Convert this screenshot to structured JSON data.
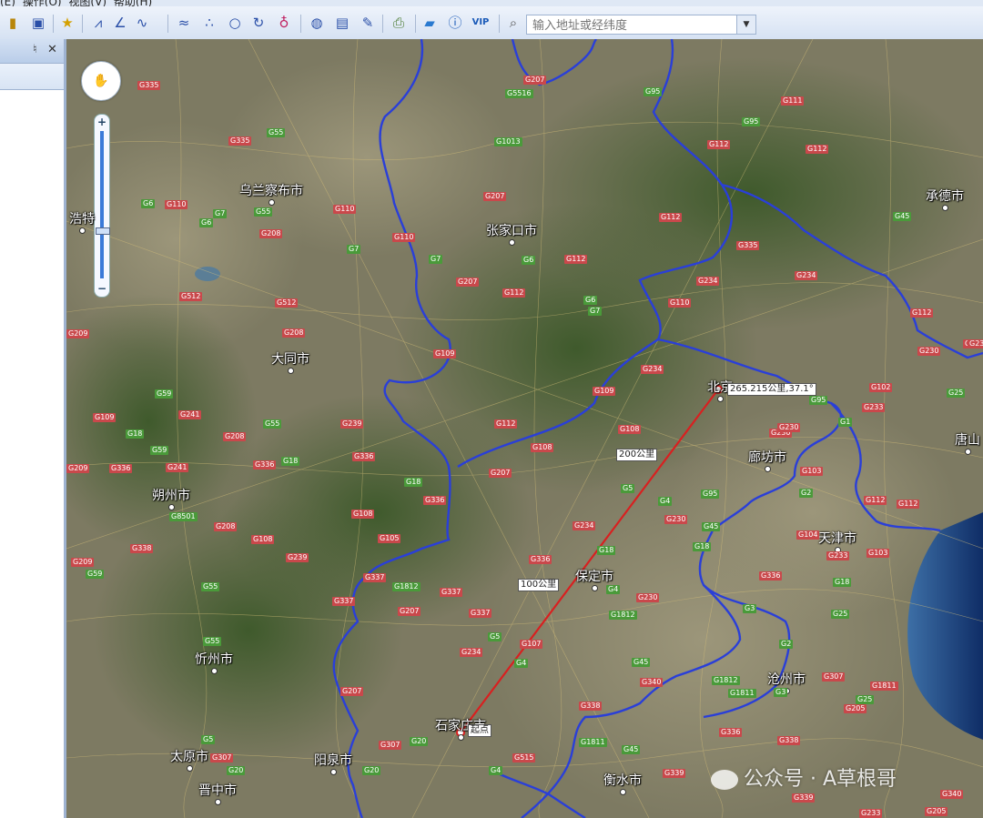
{
  "menu": {
    "items": [
      "(E)",
      "操作(O)",
      "视图(V)",
      "帮助(H)"
    ]
  },
  "toolbar": {
    "icons": [
      "ruler-icon",
      "screen-icon",
      "star-pin-icon",
      "polyline-icon",
      "angle-icon",
      "curve-icon",
      "road-icon",
      "points-icon",
      "circle-icon",
      "arc-icon",
      "ellipse-icon",
      "globe-icon",
      "map-icon",
      "pen-icon",
      "print-icon",
      "chat-icon",
      "info-icon",
      "vip-icon",
      "search-icon"
    ],
    "vip_label": "VIP",
    "search_placeholder": "输入地址或经纬度"
  },
  "panel": {
    "pin": "♮",
    "close": "✕"
  },
  "map": {
    "nav_glyph": "✋",
    "zoom_in": "+",
    "zoom_out": "−",
    "cities": [
      {
        "name": "乌兰察布市"
      },
      {
        "name": "张家口市"
      },
      {
        "name": "承德市"
      },
      {
        "name": "浩特"
      },
      {
        "name": "大同市"
      },
      {
        "name": "北京"
      },
      {
        "name": "廊坊市"
      },
      {
        "name": "唐山"
      },
      {
        "name": "朔州市"
      },
      {
        "name": "天津市"
      },
      {
        "name": "保定市"
      },
      {
        "name": "忻州市"
      },
      {
        "name": "沧州市"
      },
      {
        "name": "石家庄市"
      },
      {
        "name": "太原市"
      },
      {
        "name": "阳泉市"
      },
      {
        "name": "衡水市"
      },
      {
        "name": "晋中市"
      }
    ],
    "roads": [
      {
        "t": "r",
        "n": "G335"
      },
      {
        "t": "g",
        "n": "G5516"
      },
      {
        "t": "r",
        "n": "G207"
      },
      {
        "t": "g",
        "n": "G95"
      },
      {
        "t": "r",
        "n": "G111"
      },
      {
        "t": "r",
        "n": "G335"
      },
      {
        "t": "g",
        "n": "G55"
      },
      {
        "t": "g",
        "n": "G1013"
      },
      {
        "t": "g",
        "n": "G95"
      },
      {
        "t": "r",
        "n": "G112"
      },
      {
        "t": "r",
        "n": "G112"
      },
      {
        "t": "g",
        "n": "G6"
      },
      {
        "t": "r",
        "n": "G110"
      },
      {
        "t": "g",
        "n": "G7"
      },
      {
        "t": "g",
        "n": "G55"
      },
      {
        "t": "r",
        "n": "G110"
      },
      {
        "t": "r",
        "n": "G207"
      },
      {
        "t": "r",
        "n": "G112"
      },
      {
        "t": "g",
        "n": "G45"
      },
      {
        "t": "g",
        "n": "G6"
      },
      {
        "t": "r",
        "n": "G208"
      },
      {
        "t": "g",
        "n": "G7"
      },
      {
        "t": "r",
        "n": "G110"
      },
      {
        "t": "g",
        "n": "G7"
      },
      {
        "t": "g",
        "n": "G6"
      },
      {
        "t": "r",
        "n": "G112"
      },
      {
        "t": "r",
        "n": "G335"
      },
      {
        "t": "r",
        "n": "G234"
      },
      {
        "t": "r",
        "n": "G512"
      },
      {
        "t": "r",
        "n": "G512"
      },
      {
        "t": "r",
        "n": "G207"
      },
      {
        "t": "r",
        "n": "G112"
      },
      {
        "t": "g",
        "n": "G6"
      },
      {
        "t": "g",
        "n": "G7"
      },
      {
        "t": "r",
        "n": "G110"
      },
      {
        "t": "r",
        "n": "G234"
      },
      {
        "t": "r",
        "n": "G112"
      },
      {
        "t": "r",
        "n": "G209"
      },
      {
        "t": "r",
        "n": "G208"
      },
      {
        "t": "r",
        "n": "G230"
      },
      {
        "t": "r",
        "n": "G230"
      },
      {
        "t": "r",
        "n": "G109"
      },
      {
        "t": "r",
        "n": "G234"
      },
      {
        "t": "g",
        "n": "G59"
      },
      {
        "t": "r",
        "n": "G109"
      },
      {
        "t": "g",
        "n": "G95"
      },
      {
        "t": "r",
        "n": "G102"
      },
      {
        "t": "g",
        "n": "G25"
      },
      {
        "t": "r",
        "n": "G109"
      },
      {
        "t": "r",
        "n": "G241"
      },
      {
        "t": "r",
        "n": "G239"
      },
      {
        "t": "g",
        "n": "G55"
      },
      {
        "t": "r",
        "n": "G112"
      },
      {
        "t": "r",
        "n": "G108"
      },
      {
        "t": "r",
        "n": "G230"
      },
      {
        "t": "r",
        "n": "G233"
      },
      {
        "t": "g",
        "n": "G1"
      },
      {
        "t": "g",
        "n": "G18"
      },
      {
        "t": "r",
        "n": "G208"
      },
      {
        "t": "g",
        "n": "G59"
      },
      {
        "t": "r",
        "n": "G336"
      },
      {
        "t": "r",
        "n": "G108"
      },
      {
        "t": "r",
        "n": "G209"
      },
      {
        "t": "r",
        "n": "G336"
      },
      {
        "t": "r",
        "n": "G241"
      },
      {
        "t": "r",
        "n": "G336"
      },
      {
        "t": "g",
        "n": "G18"
      },
      {
        "t": "r",
        "n": "G207"
      },
      {
        "t": "r",
        "n": "G103"
      },
      {
        "t": "g",
        "n": "G18"
      },
      {
        "t": "g",
        "n": "G5"
      },
      {
        "t": "g",
        "n": "G95"
      },
      {
        "t": "g",
        "n": "G2"
      },
      {
        "t": "r",
        "n": "G336"
      },
      {
        "t": "g",
        "n": "G4"
      },
      {
        "t": "r",
        "n": "G112"
      },
      {
        "t": "g",
        "n": "G8501"
      },
      {
        "t": "r",
        "n": "G108"
      },
      {
        "t": "r",
        "n": "G230"
      },
      {
        "t": "r",
        "n": "G208"
      },
      {
        "t": "r",
        "n": "G108"
      },
      {
        "t": "r",
        "n": "G234"
      },
      {
        "t": "g",
        "n": "G45"
      },
      {
        "t": "r",
        "n": "G338"
      },
      {
        "t": "r",
        "n": "G239"
      },
      {
        "t": "r",
        "n": "G105"
      },
      {
        "t": "g",
        "n": "G18"
      },
      {
        "t": "g",
        "n": "G18"
      },
      {
        "t": "r",
        "n": "G104"
      },
      {
        "t": "r",
        "n": "G233"
      },
      {
        "t": "r",
        "n": "G103"
      },
      {
        "t": "r",
        "n": "G209"
      },
      {
        "t": "g",
        "n": "G59"
      },
      {
        "t": "r",
        "n": "G336"
      },
      {
        "t": "r",
        "n": "G337"
      },
      {
        "t": "g",
        "n": "G1812"
      },
      {
        "t": "r",
        "n": "G337"
      },
      {
        "t": "r",
        "n": "G336"
      },
      {
        "t": "g",
        "n": "G18"
      },
      {
        "t": "g",
        "n": "G55"
      },
      {
        "t": "g",
        "n": "G4"
      },
      {
        "t": "r",
        "n": "G230"
      },
      {
        "t": "r",
        "n": "G337"
      },
      {
        "t": "r",
        "n": "G207"
      },
      {
        "t": "r",
        "n": "G337"
      },
      {
        "t": "g",
        "n": "G1812"
      },
      {
        "t": "g",
        "n": "G3"
      },
      {
        "t": "g",
        "n": "G25"
      },
      {
        "t": "g",
        "n": "G55"
      },
      {
        "t": "g",
        "n": "G5"
      },
      {
        "t": "r",
        "n": "G234"
      },
      {
        "t": "r",
        "n": "G107"
      },
      {
        "t": "g",
        "n": "G4"
      },
      {
        "t": "g",
        "n": "G45"
      },
      {
        "t": "g",
        "n": "G2"
      },
      {
        "t": "r",
        "n": "G307"
      },
      {
        "t": "r",
        "n": "G207"
      },
      {
        "t": "r",
        "n": "G340"
      },
      {
        "t": "g",
        "n": "G1812"
      },
      {
        "t": "g",
        "n": "G1811"
      },
      {
        "t": "g",
        "n": "G3"
      },
      {
        "t": "r",
        "n": "G1811"
      },
      {
        "t": "g",
        "n": "G25"
      },
      {
        "t": "r",
        "n": "G205"
      },
      {
        "t": "r",
        "n": "G338"
      },
      {
        "t": "r",
        "n": "G336"
      },
      {
        "t": "g",
        "n": "G5"
      },
      {
        "t": "r",
        "n": "G307"
      },
      {
        "t": "g",
        "n": "G20"
      },
      {
        "t": "g",
        "n": "G1811"
      },
      {
        "t": "g",
        "n": "G45"
      },
      {
        "t": "r",
        "n": "G338"
      },
      {
        "t": "r",
        "n": "G307"
      },
      {
        "t": "g",
        "n": "G20"
      },
      {
        "t": "r",
        "n": "G515"
      },
      {
        "t": "g",
        "n": "G20"
      },
      {
        "t": "g",
        "n": "G4"
      },
      {
        "t": "r",
        "n": "G339"
      },
      {
        "t": "r",
        "n": "G339"
      },
      {
        "t": "r",
        "n": "G340"
      },
      {
        "t": "r",
        "n": "G233"
      },
      {
        "t": "r",
        "n": "G205"
      },
      {
        "t": "r",
        "n": "G230"
      },
      {
        "t": "r",
        "n": "G112"
      },
      {
        "t": "r",
        "n": "G230"
      }
    ],
    "measure": {
      "start_label": "起点",
      "mid_label_1": "100公里",
      "mid_label_2": "200公里",
      "end_label": "265.215公里,37.1°"
    },
    "watermark": "公众号 · A草根哥"
  },
  "colors": {
    "boundary": "#2a3fd8",
    "measure_line": "#d82020",
    "road_green": "#4a9a3a",
    "road_red": "#c9484b"
  }
}
